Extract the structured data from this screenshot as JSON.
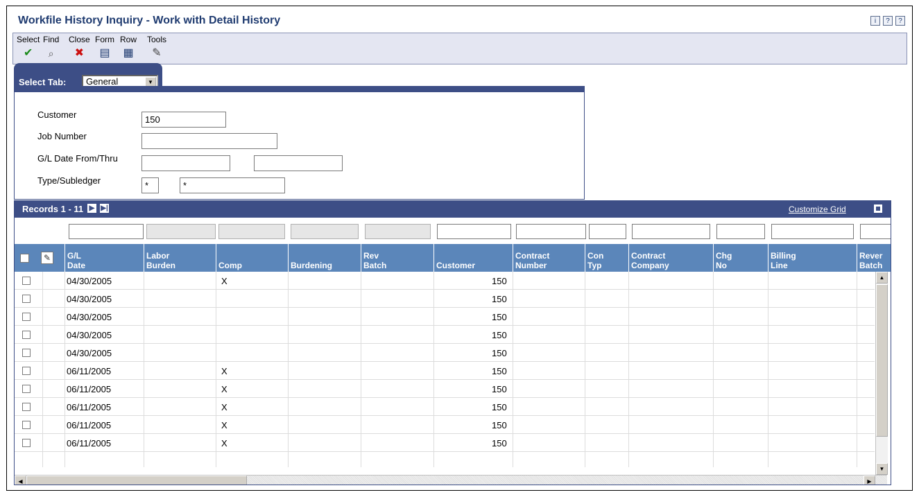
{
  "window": {
    "title": "Workfile History Inquiry - Work with Detail History",
    "help_icons": [
      "i",
      "?",
      "?"
    ]
  },
  "toolbar": {
    "items": [
      {
        "label": "Select",
        "icon": "checkmark-icon",
        "glyph": "✔",
        "color": "#1a8a1a"
      },
      {
        "label": "Find",
        "icon": "find-icon",
        "glyph": "🔍",
        "color": "#555555"
      },
      {
        "label": "Close",
        "icon": "close-icon",
        "glyph": "✖",
        "color": "#cc1111"
      },
      {
        "label": "Form",
        "icon": "form-icon",
        "glyph": "▤",
        "color": "#1f3b70"
      },
      {
        "label": "Row",
        "icon": "row-icon",
        "glyph": "▦",
        "color": "#1f3b70"
      },
      {
        "label": "Tools",
        "icon": "tools-icon",
        "glyph": "✎",
        "color": "#444444"
      }
    ]
  },
  "tab": {
    "label": "Select Tab:",
    "selected": "General"
  },
  "form": {
    "customer_label": "Customer",
    "customer_value": "150",
    "job_label": "Job Number",
    "job_value": "",
    "gl_date_label": "G/L Date From/Thru",
    "gl_from": "",
    "gl_thru": "",
    "type_label": "Type/Subledger",
    "type_value": "*",
    "subledger_value": "*"
  },
  "grid": {
    "records_label": "Records 1 - 11",
    "customize_label": "Customize Grid",
    "columns": [
      {
        "label": "G/L\nDate"
      },
      {
        "label": "Labor\nBurden"
      },
      {
        "label": "Comp"
      },
      {
        "label": "Burdening"
      },
      {
        "label": "Rev\nBatch"
      },
      {
        "label": "Customer"
      },
      {
        "label": "Contract\nNumber"
      },
      {
        "label": "Con\nTyp"
      },
      {
        "label": "Contract\nCompany"
      },
      {
        "label": "Chg\nNo"
      },
      {
        "label": "Billing\nLine"
      },
      {
        "label": "Rever\nBatch"
      }
    ],
    "rows": [
      {
        "date": "04/30/2005",
        "comp": "X",
        "customer": "150"
      },
      {
        "date": "04/30/2005",
        "comp": "",
        "customer": "150"
      },
      {
        "date": "04/30/2005",
        "comp": "",
        "customer": "150"
      },
      {
        "date": "04/30/2005",
        "comp": "",
        "customer": "150"
      },
      {
        "date": "04/30/2005",
        "comp": "",
        "customer": "150"
      },
      {
        "date": "06/11/2005",
        "comp": "X",
        "customer": "150"
      },
      {
        "date": "06/11/2005",
        "comp": "X",
        "customer": "150"
      },
      {
        "date": "06/11/2005",
        "comp": "X",
        "customer": "150"
      },
      {
        "date": "06/11/2005",
        "comp": "X",
        "customer": "150"
      },
      {
        "date": "06/11/2005",
        "comp": "X",
        "customer": "150"
      }
    ]
  }
}
